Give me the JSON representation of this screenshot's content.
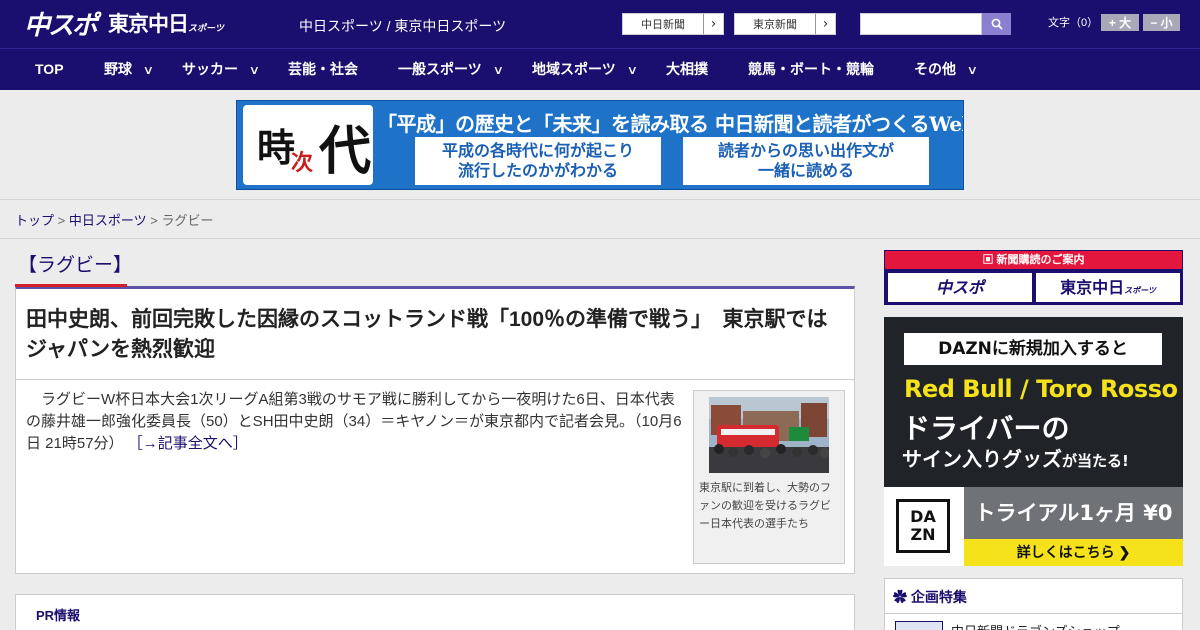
{
  "header": {
    "logo_primary": "中スポ",
    "logo_secondary": "東京中日",
    "logo_secondary_small": "スポーツ",
    "site_links": "中日スポーツ / 東京中日スポーツ",
    "paper_buttons": [
      "中日新聞",
      "東京新聞"
    ],
    "search": {
      "placeholder": ""
    },
    "font_size_label": "文字（0）",
    "font_bigger": "+ 大",
    "font_smaller": "− 小"
  },
  "nav": [
    {
      "label": "TOP",
      "has_dropdown": false
    },
    {
      "label": "野球",
      "has_dropdown": true
    },
    {
      "label": "サッカー",
      "has_dropdown": true
    },
    {
      "label": "芸能・社会",
      "has_dropdown": false
    },
    {
      "label": "一般スポーツ",
      "has_dropdown": true
    },
    {
      "label": "地域スポーツ",
      "has_dropdown": true
    },
    {
      "label": "大相撲",
      "has_dropdown": false
    },
    {
      "label": "競馬・ボート・競輪",
      "has_dropdown": false
    },
    {
      "label": "その他",
      "has_dropdown": true
    }
  ],
  "banner": {
    "logo_chars": [
      "時",
      "次",
      "代"
    ],
    "headline": "「平成」の歴史と「未来」を読み取る 中日新聞と読者がつくるWebサイト",
    "box_left": [
      "平成の各時代に何が起こり",
      "流行したのかがわかる"
    ],
    "box_right": [
      "読者からの思い出作文が",
      "一緒に読める"
    ]
  },
  "breadcrumb": {
    "items": [
      "トップ",
      "中日スポーツ"
    ],
    "current": "ラグビー",
    "separator": ">"
  },
  "category": {
    "title": "【ラグビー】"
  },
  "article": {
    "headline": "田中史朗、前回完敗した因縁のスコットランド戦「100％の準備で戦う」　東京駅ではジャパンを熱烈歓迎",
    "lead": "　ラグビーW杯日本大会1次リーグA組第3戦のサモア戦に勝利してから一夜明けた6日、日本代表の藤井雄一郎強化委員長（50）とSH田中史朗（34）＝キヤノン＝が東京都内で記者会見。（10月6日 21時57分）",
    "more_link": "［→記事全文へ］",
    "photo_caption": "東京駅に到着し、大勢のファンの歓迎を受けるラグビー日本代表の選手たち"
  },
  "pr": {
    "title": "PR情報"
  },
  "sidebar": {
    "subscription": {
      "header": "新聞購読のご案内",
      "buttons": [
        "中スポ",
        "東京中日"
      ],
      "button_small": "スポーツ"
    },
    "ad": {
      "top_prefix": "DAZN",
      "top_text": "に新規加入すると",
      "yellow": "Red Bull / Toro Rosso",
      "white1": "ドライバーの",
      "white2_main": "サイン入りグッズ",
      "white2_suffix": "が当たる!",
      "logo_top": "DA",
      "logo_bottom": "ZN",
      "trial": "トライアル1ヶ月 ¥0",
      "more": "詳しくはこちら ❯"
    },
    "feature": {
      "header": "企画特集",
      "item": "中日新聞ドラゴンズショップ"
    }
  },
  "colors": {
    "header_bg": "#1a0e6e",
    "accent_red": "#d2212a",
    "banner_blue": "#1e73c8",
    "ad_yellow": "#f5e21a"
  }
}
